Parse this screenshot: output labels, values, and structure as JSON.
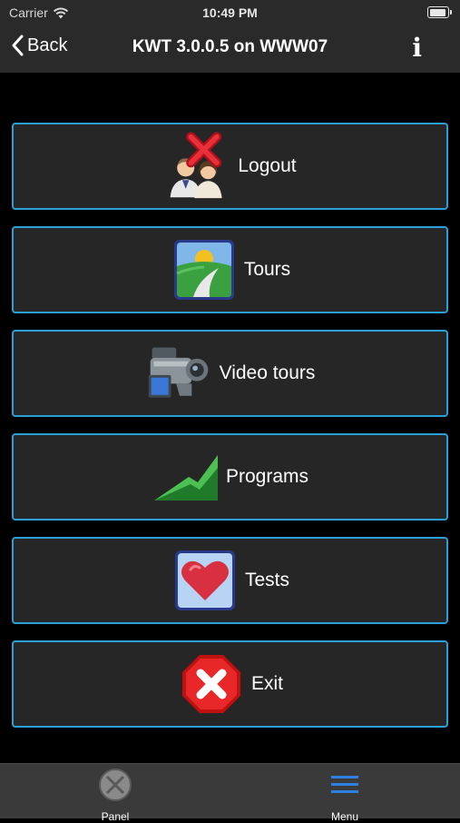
{
  "status": {
    "carrier": "Carrier",
    "time": "10:49 PM"
  },
  "nav": {
    "back_label": "Back",
    "title": "KWT 3.0.0.5 on WWW07",
    "info_label": "i"
  },
  "menu": {
    "items": [
      {
        "label": "Logout",
        "icon": "logout-users-icon"
      },
      {
        "label": "Tours",
        "icon": "tours-road-icon"
      },
      {
        "label": "Video tours",
        "icon": "video-camera-icon"
      },
      {
        "label": "Programs",
        "icon": "programs-chart-icon"
      },
      {
        "label": "Tests",
        "icon": "tests-heart-icon"
      },
      {
        "label": "Exit",
        "icon": "exit-stop-icon"
      }
    ]
  },
  "tabs": {
    "panel_label": "Panel",
    "menu_label": "Menu"
  },
  "colors": {
    "accent_border": "#2a9fd8",
    "button_bg": "#262626",
    "bar_bg": "#2a2a2a",
    "tab_active": "#2f7fe0"
  }
}
